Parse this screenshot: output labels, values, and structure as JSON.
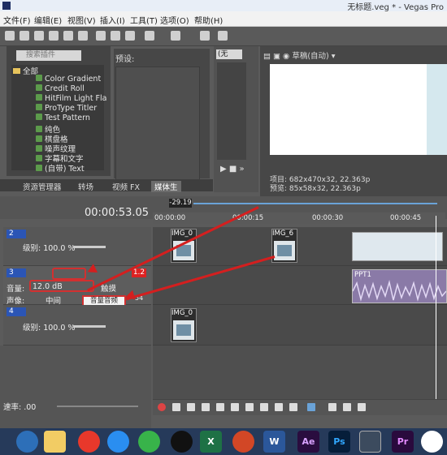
{
  "titlebar": {
    "title": "无标题.veg * - Vegas Pro"
  },
  "menu": [
    "文件(F)",
    "编辑(E)",
    "视图(V)",
    "插入(I)",
    "工具(T)",
    "选项(O)",
    "帮助(H)"
  ],
  "explorer": {
    "search_placeholder": "搜索插件",
    "items": [
      "全部",
      "Color Gradient",
      "Credit Roll",
      "HitFilm Light Fla",
      "ProType Titler",
      "Test Pattern",
      "纯色",
      "棋盘格",
      "噪声纹理",
      "字幕和文字",
      "(自带) Text"
    ]
  },
  "presets": {
    "label": "预设:"
  },
  "tabs": [
    "资源管理器",
    "转场",
    "视频 FX",
    "媒体生"
  ],
  "trimmer": {
    "select": "(无"
  },
  "preview": {
    "quality": "草稿(自动)",
    "project": "项目: 682x470x32, 22.363p",
    "preview": "预览: 85x58x32, 22.363p"
  },
  "timeline": {
    "timecode": "00:00:53.05",
    "marker": "-29.19",
    "ruler": [
      "00:00:00",
      "00:00:15",
      "00:00:30",
      "00:00:45"
    ]
  },
  "tracks": [
    {
      "num": "2",
      "label1": "级别: 100.0 %"
    },
    {
      "num": "3",
      "volume_label": "音量:",
      "volume": "12.0 dB",
      "pan_label": "声像:",
      "pan": "中间",
      "mode": "触摸",
      "tooltip": "音量音频",
      "badge": "1.2",
      "meter": "54"
    },
    {
      "num": "4",
      "label1": "级别: 100.0 %"
    }
  ],
  "clips": [
    "IMG_0",
    "IMG_6",
    "IMG_0",
    "PPT1"
  ],
  "rate": {
    "label": "速率: .00"
  },
  "taskbar": [
    "Ae",
    "Ps",
    "Pr",
    "W",
    "X"
  ],
  "colors": {
    "accent_red": "#d41f1f",
    "track_blue": "#2b55b5"
  }
}
